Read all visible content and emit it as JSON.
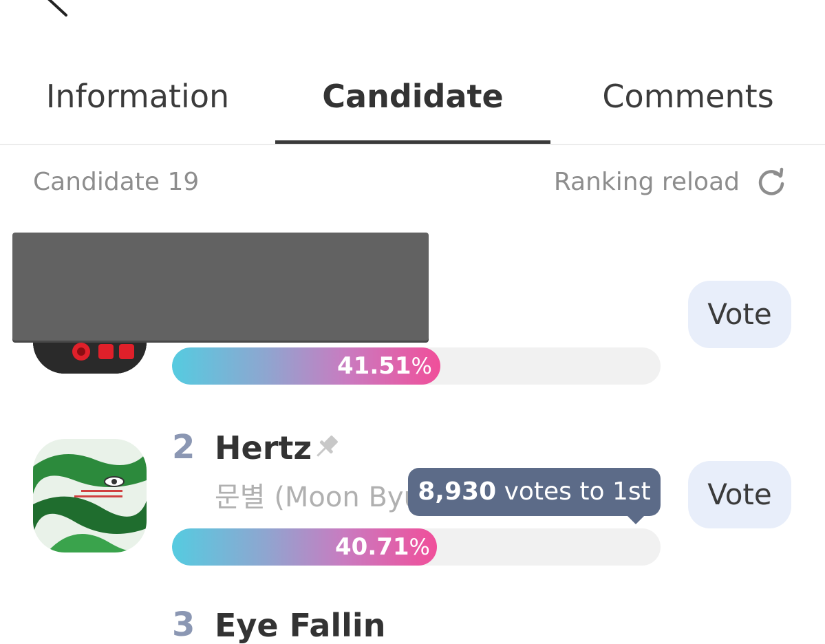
{
  "tabs": [
    {
      "label": "Information"
    },
    {
      "label": "Candidate"
    },
    {
      "label": "Comments"
    }
  ],
  "candidate_count": "Candidate 19",
  "ranking_reload": "Ranking reload",
  "vote_label": "Vote",
  "rows": [
    {
      "percent_value": "41.51",
      "percent_sign": "%",
      "percent": 41.51
    },
    {
      "rank": "2",
      "name": "Hertz",
      "subtitle": "문별 (Moon Byu",
      "percent_value": "40.71",
      "percent_sign": "%",
      "percent": 40.71
    },
    {
      "rank": "3",
      "name": "Eye Fallin"
    }
  ],
  "tooltip": {
    "votes": "8,930",
    "text": "votes to 1st"
  },
  "colors": {
    "accent_start": "#55cbe0",
    "accent_end": "#f04f9a",
    "vote_bg": "#e8eefa",
    "tooltip_bg": "#5c6b88"
  }
}
